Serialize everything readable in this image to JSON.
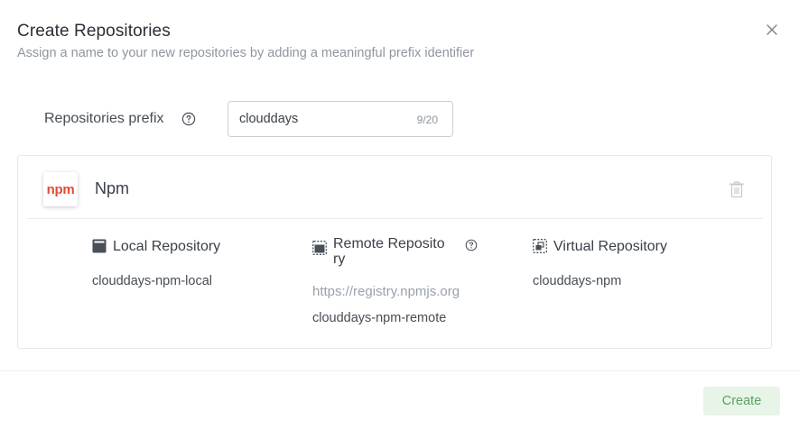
{
  "dialog": {
    "title": "Create Repositories",
    "subtitle": "Assign a name to your new repositories by adding a meaningful prefix identifier",
    "close_icon": "close-icon"
  },
  "prefix": {
    "label": "Repositories prefix",
    "help_icon": "help-circle-icon",
    "value": "clouddays",
    "counter": "9/20"
  },
  "package": {
    "logo_text": "npm",
    "name": "Npm",
    "delete_icon": "trash-icon",
    "repositories": {
      "local": {
        "icon": "local-repo-icon",
        "title": "Local Repository",
        "name": "clouddays-npm-local"
      },
      "remote": {
        "icon": "remote-repo-icon",
        "title_line1": "Remote Reposito",
        "title_line2": "ry",
        "help_icon": "help-circle-icon",
        "url": "https://registry.npmjs.org",
        "name": "clouddays-npm-remote"
      },
      "virtual": {
        "icon": "virtual-repo-icon",
        "title": "Virtual Repository",
        "name": "clouddays-npm"
      }
    }
  },
  "footer": {
    "create_label": "Create"
  },
  "colors": {
    "npm_brand": "#e34a34",
    "create_button_bg": "#e9f4e9",
    "create_button_text": "#55a35c",
    "muted_text": "#8f96a0"
  }
}
